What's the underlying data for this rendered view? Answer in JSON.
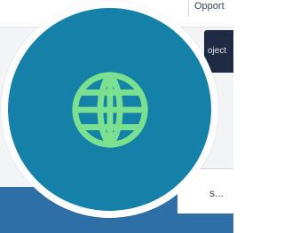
{
  "top_tab": {
    "label": "Opport"
  },
  "dark_chip": {
    "label": "oject"
  },
  "bottom_right": {
    "label": "s..."
  },
  "badge": {
    "icon": "globe-icon",
    "circle_color": "#1580a8",
    "ring_color": "#ffffff",
    "icon_color": "#7be08f"
  }
}
